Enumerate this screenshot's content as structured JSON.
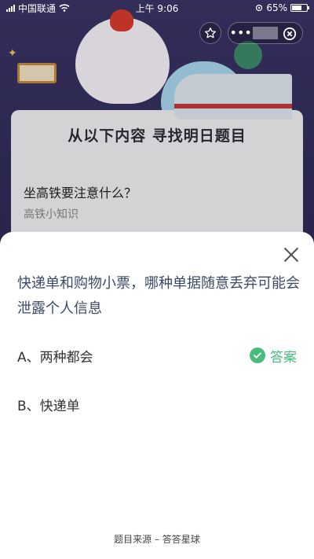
{
  "status_bar": {
    "carrier": "中国联通",
    "time": "上午 9:06",
    "battery": "65%"
  },
  "capsule": {
    "favorite_icon": "star-outline-icon",
    "more_icon": "more-dots-icon",
    "close_icon": "circle-close-icon"
  },
  "background_card": {
    "title": "从以下内容 寻找明日题目",
    "question": "坐高铁要注意什么？",
    "subtitle": "高铁小知识"
  },
  "sheet": {
    "question": "快递单和购物小票，哪种单据随意丢弃可能会泄露个人信息",
    "options": [
      {
        "label": "A、两种都会",
        "is_answer": true
      },
      {
        "label": "B、快递单",
        "is_answer": false
      }
    ],
    "answer_label": "答案",
    "footer": "题目来源 – 答答星球"
  },
  "colors": {
    "question_text": "#3b4a6a",
    "answer_green": "#48bd7e",
    "background": "#2f2b58"
  }
}
